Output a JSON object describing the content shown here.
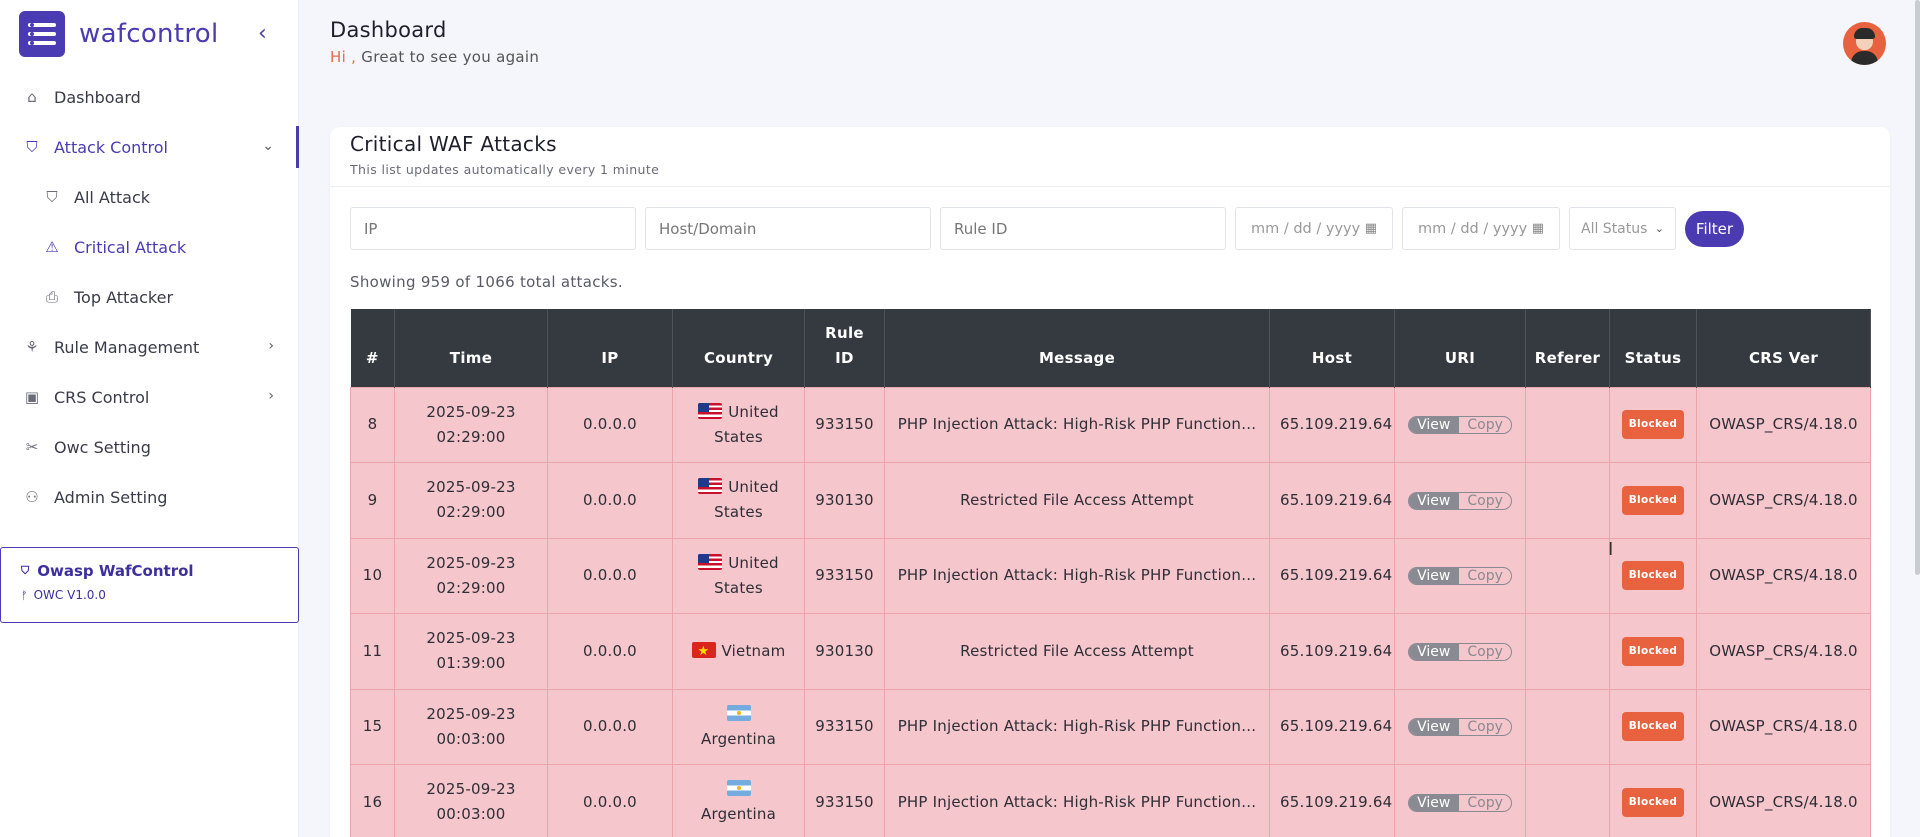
{
  "brand": {
    "name": "wafcontrol"
  },
  "nav": {
    "dashboard": "Dashboard",
    "attack_control": "Attack Control",
    "all_attack": "All Attack",
    "critical_attack": "Critical Attack",
    "top_attacker": "Top Attacker",
    "rule_management": "Rule Management",
    "crs_control": "CRS Control",
    "owc_setting": "Owc Setting",
    "admin_setting": "Admin Setting"
  },
  "version": {
    "title": "Owasp WafControl",
    "label": "OWC V1.0.0"
  },
  "header": {
    "title": "Dashboard",
    "hi": "Hi ,",
    "greeting": "Great to see you again"
  },
  "card": {
    "title": "Critical WAF Attacks",
    "subtitle": "This list updates automatically every 1 minute"
  },
  "filters": {
    "ip_placeholder": "IP",
    "host_placeholder": "Host/Domain",
    "rule_placeholder": "Rule ID",
    "date_from": "mm / dd / yyyy",
    "date_to": "mm / dd / yyyy",
    "status": "All Status",
    "button": "Filter"
  },
  "summary": "Showing 959 of 1066 total attacks.",
  "table": {
    "headers": {
      "num": "#",
      "time": "Time",
      "ip": "IP",
      "country": "Country",
      "rule_line1": "Rule",
      "rule_line2": "ID",
      "message": "Message",
      "host": "Host",
      "uri": "URI",
      "referer": "Referer",
      "status": "Status",
      "crs": "CRS Ver"
    },
    "view_label": "View",
    "copy_label": "Copy",
    "rows": [
      {
        "num": "8",
        "date": "2025-09-23",
        "clock": "02:29:00",
        "ip": "0.0.0.0",
        "flag": "us",
        "country_a": "United",
        "country_b": "States",
        "rule": "933150",
        "message": "PHP Injection Attack: High-Risk PHP Function…",
        "host": "65.109.219.64",
        "referer": "",
        "status": "Blocked",
        "crs": "OWASP_CRS/4.18.0"
      },
      {
        "num": "9",
        "date": "2025-09-23",
        "clock": "02:29:00",
        "ip": "0.0.0.0",
        "flag": "us",
        "country_a": "United",
        "country_b": "States",
        "rule": "930130",
        "message": "Restricted File Access Attempt",
        "host": "65.109.219.64",
        "referer": "",
        "status": "Blocked",
        "crs": "OWASP_CRS/4.18.0"
      },
      {
        "num": "10",
        "date": "2025-09-23",
        "clock": "02:29:00",
        "ip": "0.0.0.0",
        "flag": "us",
        "country_a": "United",
        "country_b": "States",
        "rule": "933150",
        "message": "PHP Injection Attack: High-Risk PHP Function…",
        "host": "65.109.219.64",
        "referer": "",
        "status": "Blocked",
        "crs": "OWASP_CRS/4.18.0"
      },
      {
        "num": "11",
        "date": "2025-09-23",
        "clock": "01:39:00",
        "ip": "0.0.0.0",
        "flag": "vn",
        "country_a": "Vietnam",
        "country_b": "",
        "rule": "930130",
        "message": "Restricted File Access Attempt",
        "host": "65.109.219.64",
        "referer": "",
        "status": "Blocked",
        "crs": "OWASP_CRS/4.18.0"
      },
      {
        "num": "15",
        "date": "2025-09-23",
        "clock": "00:03:00",
        "ip": "0.0.0.0",
        "flag": "ar",
        "country_a": "",
        "country_b": "Argentina",
        "rule": "933150",
        "message": "PHP Injection Attack: High-Risk PHP Function…",
        "host": "65.109.219.64",
        "referer": "",
        "status": "Blocked",
        "crs": "OWASP_CRS/4.18.0"
      },
      {
        "num": "16",
        "date": "2025-09-23",
        "clock": "00:03:00",
        "ip": "0.0.0.0",
        "flag": "ar",
        "country_a": "",
        "country_b": "Argentina",
        "rule": "933150",
        "message": "PHP Injection Attack: High-Risk PHP Function…",
        "host": "65.109.219.64",
        "referer": "",
        "status": "Blocked",
        "crs": "OWASP_CRS/4.18.0"
      }
    ]
  },
  "colors": {
    "accent": "#4b3bb3",
    "row_bg": "#f5c6cb",
    "badge": "#e8623f",
    "header_bg": "#343a40"
  }
}
